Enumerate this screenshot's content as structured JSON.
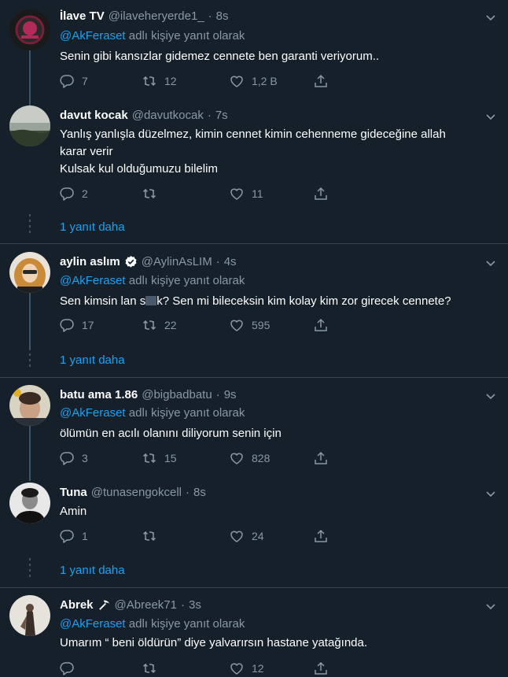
{
  "labels": {
    "reply_suffix": "adlı kişiye yanıt olarak",
    "more_replies": "1 yanıt daha"
  },
  "colors": {
    "background": "#15202b",
    "accent": "#1da1f2",
    "muted": "#8899a6",
    "divider": "#38444d"
  },
  "tweets": [
    {
      "name": "İlave TV",
      "handle": "@ilaveheryerde1_",
      "time": "8s",
      "reply_to": "@AkFeraset",
      "text": "Senin gibi kansızlar gidemez cennete ben garanti veriyorum..",
      "replies": "7",
      "retweets": "12",
      "likes": "1,2 B"
    },
    {
      "name": "davut kocak",
      "handle": "@davutkocak",
      "time": "7s",
      "text_line1": "Yanlış yanlışla düzelmez, kimin cennet kimin cehenneme gideceğine allah",
      "text_line2": "karar verir",
      "text_line3": "Kulsak kul olduğumuzu bilelim",
      "replies": "2",
      "retweets": "",
      "likes": "11"
    },
    {
      "name": "aylin aslım",
      "handle": "@AylinAsLIM",
      "time": "4s",
      "reply_to": "@AkFeraset",
      "text_a": "Sen kimsin lan s",
      "text_b": "k? Sen mi bileceksin kim kolay kim zor girecek cennete?",
      "replies": "17",
      "retweets": "22",
      "likes": "595"
    },
    {
      "name": "batu ama 1.86",
      "handle": "@bigbadbatu",
      "time": "9s",
      "reply_to": "@AkFeraset",
      "text": "ölümün en acılı olanını diliyorum senin için",
      "replies": "3",
      "retweets": "15",
      "likes": "828"
    },
    {
      "name": "Tuna",
      "handle": "@tunasengokcell",
      "time": "8s",
      "text": "Amin",
      "replies": "1",
      "retweets": "",
      "likes": "24"
    },
    {
      "name": "Abrek",
      "handle": "@Abreek71",
      "time": "3s",
      "reply_to": "@AkFeraset",
      "text": "Umarım “ beni öldürün” diye yalvarırsın hastane yatağında.",
      "replies": "",
      "retweets": "",
      "likes": "12"
    }
  ]
}
